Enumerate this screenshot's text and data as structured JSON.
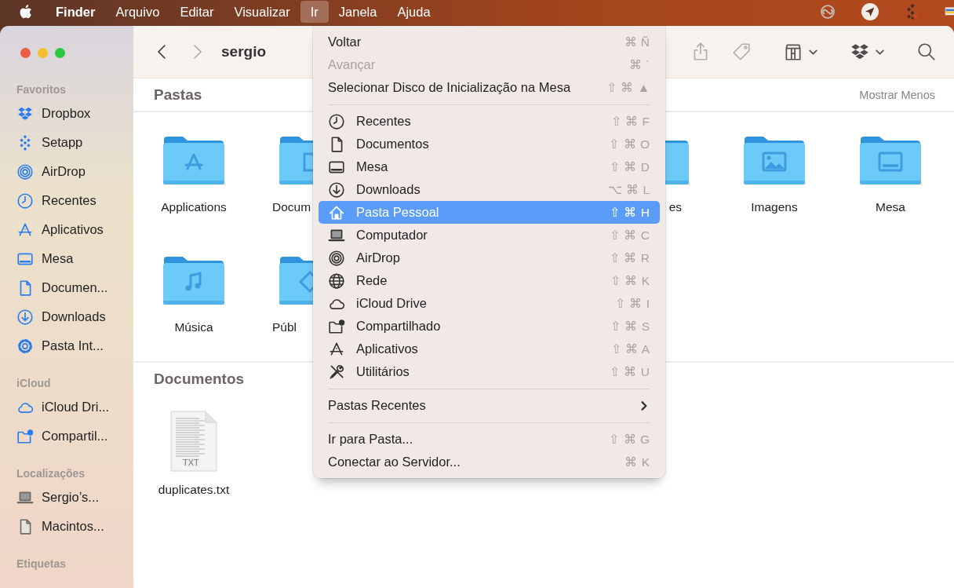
{
  "menu_bar": {
    "items": [
      {
        "label": "Finder",
        "kind": "app",
        "selected": false
      },
      {
        "label": "Arquivo",
        "kind": "menu",
        "selected": false
      },
      {
        "label": "Editar",
        "kind": "menu",
        "selected": false
      },
      {
        "label": "Visualizar",
        "kind": "menu",
        "selected": false
      },
      {
        "label": "Ir",
        "kind": "menu",
        "selected": true
      },
      {
        "label": "Janela",
        "kind": "menu",
        "selected": false
      },
      {
        "label": "Ajuda",
        "kind": "menu",
        "selected": false
      }
    ]
  },
  "window": {
    "title": "sergio",
    "navigation": [
      {
        "kind": "back",
        "disabled": false
      },
      {
        "kind": "forward",
        "disabled": true
      }
    ]
  },
  "sidebar": {
    "sections": [
      {
        "title": "Favoritos",
        "items": [
          {
            "label": "Dropbox",
            "selected": false
          },
          {
            "label": "Setapp",
            "selected": false
          },
          {
            "label": "AirDrop",
            "selected": false
          },
          {
            "label": "Recentes",
            "selected": false
          },
          {
            "label": "Aplicativos",
            "selected": false
          },
          {
            "label": "Mesa",
            "selected": false
          },
          {
            "label": "Documen...",
            "selected": false
          },
          {
            "label": "Downloads",
            "selected": false
          },
          {
            "label": "Pasta Int...",
            "selected": false
          }
        ]
      },
      {
        "title": "iCloud",
        "items": [
          {
            "label": "iCloud Dri...",
            "selected": false
          },
          {
            "label": "Compartil...",
            "selected": false
          }
        ]
      },
      {
        "title": "Localizações",
        "items": [
          {
            "label": "Sergio’s...",
            "selected": false
          },
          {
            "label": "Macintos...",
            "selected": false
          }
        ]
      },
      {
        "title": "Etiquetas"
      }
    ]
  },
  "pastas": {
    "title": "Pastas",
    "toggle": "Mostrar Menos",
    "folders": [
      {
        "name": "Applications"
      },
      {
        "name": "Docum"
      },
      {
        "name": "es"
      },
      {
        "name": "Imagens"
      },
      {
        "name": "Mesa"
      },
      {
        "name": "Música"
      },
      {
        "name": "Públ"
      }
    ]
  },
  "documentos": {
    "title": "Documentos",
    "files": [
      {
        "name": "duplicates.txt",
        "badge": "TXT"
      }
    ]
  },
  "go_menu": {
    "items": [
      {
        "kind": "command",
        "label": "Voltar",
        "shortcut": "⌘ Ñ",
        "disabled": false,
        "selected": false
      },
      {
        "kind": "command",
        "label": "Avançar",
        "shortcut": "⌘ ´",
        "disabled": true,
        "selected": false
      },
      {
        "kind": "command",
        "label": "Selecionar Disco de Inicialização na Mesa",
        "shortcut": "⇧ ⌘ ▲",
        "disabled": false,
        "selected": false
      },
      {
        "kind": "separator"
      },
      {
        "kind": "place",
        "label": "Recentes",
        "shortcut": "⇧ ⌘ F",
        "disabled": false,
        "selected": false
      },
      {
        "kind": "place",
        "label": "Documentos",
        "shortcut": "⇧ ⌘ O",
        "disabled": false,
        "selected": false
      },
      {
        "kind": "place",
        "label": "Mesa",
        "shortcut": "⇧ ⌘ D",
        "disabled": false,
        "selected": false
      },
      {
        "kind": "place",
        "label": "Downloads",
        "shortcut": "⌥ ⌘ L",
        "disabled": false,
        "selected": false
      },
      {
        "kind": "place",
        "label": "Pasta Pessoal",
        "shortcut": "⇧ ⌘ H",
        "disabled": false,
        "selected": true
      },
      {
        "kind": "place",
        "label": "Computador",
        "shortcut": "⇧ ⌘ C",
        "disabled": false,
        "selected": false
      },
      {
        "kind": "place",
        "label": "AirDrop",
        "shortcut": "⇧ ⌘ R",
        "disabled": false,
        "selected": false
      },
      {
        "kind": "place",
        "label": "Rede",
        "shortcut": "⇧ ⌘ K",
        "disabled": false,
        "selected": false
      },
      {
        "kind": "place",
        "label": "iCloud Drive",
        "shortcut": "⇧ ⌘ I",
        "disabled": false,
        "selected": false
      },
      {
        "kind": "place",
        "label": "Compartilhado",
        "shortcut": "⇧ ⌘ S",
        "disabled": false,
        "selected": false
      },
      {
        "kind": "place",
        "label": "Aplicativos",
        "shortcut": "⇧ ⌘ A",
        "disabled": false,
        "selected": false
      },
      {
        "kind": "place",
        "label": "Utilitários",
        "shortcut": "⇧ ⌘ U",
        "disabled": false,
        "selected": false
      },
      {
        "kind": "separator"
      },
      {
        "kind": "submenu",
        "label": "Pastas Recentes",
        "disabled": false,
        "selected": false
      },
      {
        "kind": "separator"
      },
      {
        "kind": "command",
        "label": "Ir para Pasta...",
        "shortcut": "⇧ ⌘ G",
        "disabled": false,
        "selected": false
      },
      {
        "kind": "command",
        "label": "Conectar ao Servidor...",
        "shortcut": "⌘ K",
        "disabled": false,
        "selected": false
      }
    ]
  }
}
